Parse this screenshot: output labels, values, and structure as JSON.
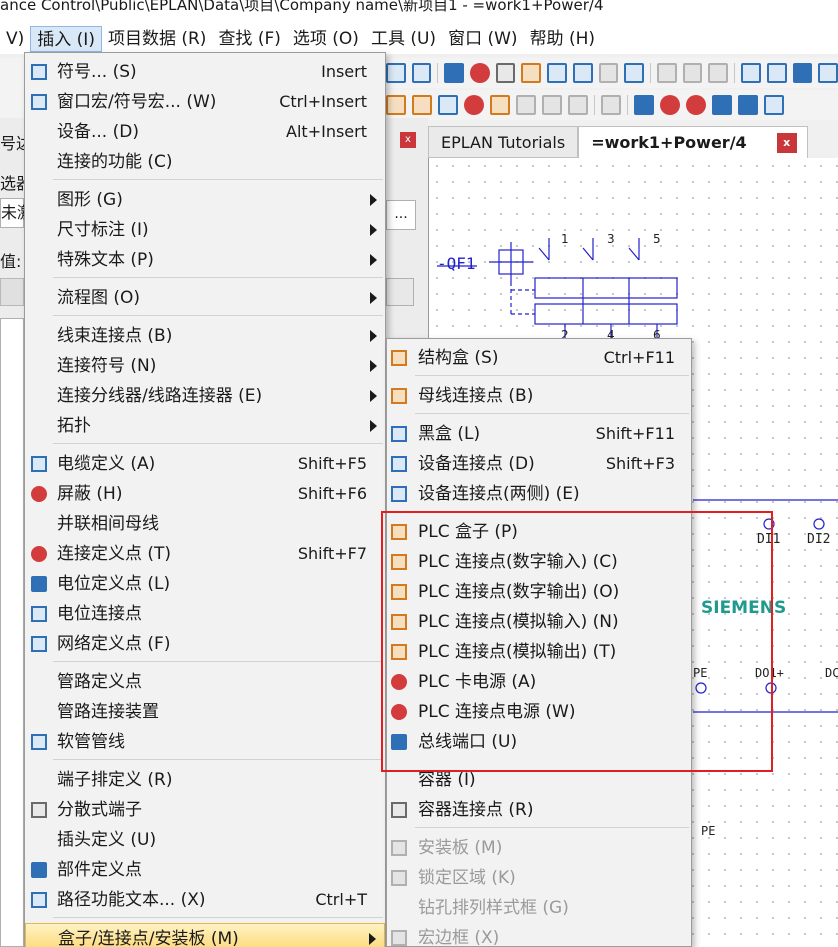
{
  "window": {
    "title": "ance Control\\Public\\EPLAN\\Data\\项目\\Company name\\新项目1 - =work1+Power/4"
  },
  "menubar": {
    "items": [
      {
        "label": "V)"
      },
      {
        "label": "插入 (I)",
        "active": true
      },
      {
        "label": "项目数据 (R)"
      },
      {
        "label": "查找 (F)"
      },
      {
        "label": "选项 (O)"
      },
      {
        "label": "工具 (U)"
      },
      {
        "label": "窗口 (W)"
      },
      {
        "label": "帮助 (H)"
      }
    ]
  },
  "left_panel": {
    "fragments": [
      "号达",
      "选器",
      "未激",
      "值:"
    ]
  },
  "tabs": [
    {
      "label": "EPLAN Tutorials"
    },
    {
      "label": "=work1+Power/4",
      "active": true,
      "close": "x"
    }
  ],
  "insert_menu": {
    "items": [
      {
        "label": "符号... (S)",
        "shortcut": "Insert",
        "icon": "symbol-icon"
      },
      {
        "label": "窗口宏/符号宏... (W)",
        "shortcut": "Ctrl+Insert",
        "icon": "macro-icon"
      },
      {
        "label": "设备... (D)",
        "shortcut": "Alt+Insert",
        "icon": ""
      },
      {
        "label": "连接的功能 (C)",
        "shortcut": "",
        "icon": ""
      },
      {
        "label": "图形 (G)",
        "submenu": true
      },
      {
        "label": "尺寸标注 (I)",
        "submenu": true
      },
      {
        "label": "特殊文本 (P)",
        "submenu": true
      },
      {
        "label": "流程图 (O)",
        "submenu": true
      },
      {
        "label": "线束连接点 (B)",
        "submenu": true
      },
      {
        "label": "连接符号 (N)",
        "submenu": true
      },
      {
        "label": "连接分线器/线路连接器 (E)",
        "submenu": true
      },
      {
        "label": "拓扑",
        "submenu": true
      },
      {
        "label": "电缆定义 (A)",
        "shortcut": "Shift+F5",
        "icon": "cable-definition-icon"
      },
      {
        "label": "屏蔽 (H)",
        "shortcut": "Shift+F6",
        "icon": "shield-icon"
      },
      {
        "label": "并联相间母线",
        "shortcut": "",
        "icon": ""
      },
      {
        "label": "连接定义点 (T)",
        "shortcut": "Shift+F7",
        "icon": "connection-definition-icon"
      },
      {
        "label": "电位定义点 (L)",
        "shortcut": "",
        "icon": "potential-definition-icon"
      },
      {
        "label": "电位连接点",
        "shortcut": "",
        "icon": "potential-connection-icon"
      },
      {
        "label": "网络定义点 (F)",
        "shortcut": "",
        "icon": "network-definition-icon"
      },
      {
        "label": "管路定义点",
        "shortcut": "",
        "icon": ""
      },
      {
        "label": "管路连接装置",
        "shortcut": "",
        "icon": ""
      },
      {
        "label": "软管管线",
        "shortcut": "",
        "icon": "hose-icon"
      },
      {
        "label": "端子排定义 (R)",
        "shortcut": "",
        "icon": ""
      },
      {
        "label": "分散式端子",
        "shortcut": "",
        "icon": "distributed-terminal-icon"
      },
      {
        "label": "插头定义 (U)",
        "shortcut": "",
        "icon": ""
      },
      {
        "label": "部件定义点",
        "shortcut": "",
        "icon": "part-definition-icon"
      },
      {
        "label": "路径功能文本... (X)",
        "shortcut": "Ctrl+T",
        "icon": "path-text-icon"
      },
      {
        "label": "盒子/连接点/安装板 (M)",
        "submenu": true,
        "highlighted": true
      }
    ]
  },
  "box_submenu": {
    "items": [
      {
        "label": "结构盒 (S)",
        "shortcut": "Ctrl+F11",
        "icon": "structure-box-icon"
      },
      {
        "label": "母线连接点 (B)",
        "shortcut": "",
        "icon": "busbar-connection-icon"
      },
      {
        "label": "黑盒 (L)",
        "shortcut": "Shift+F11",
        "icon": "black-box-icon"
      },
      {
        "label": "设备连接点 (D)",
        "shortcut": "Shift+F3",
        "icon": "device-connection-icon"
      },
      {
        "label": "设备连接点(两侧) (E)",
        "shortcut": "",
        "icon": "device-connection-both-icon"
      },
      {
        "label": "PLC 盒子 (P)",
        "shortcut": "",
        "icon": "plc-box-icon"
      },
      {
        "label": "PLC 连接点(数字输入) (C)",
        "shortcut": "",
        "icon": "plc-digital-input-icon"
      },
      {
        "label": "PLC 连接点(数字输出) (O)",
        "shortcut": "",
        "icon": "plc-digital-output-icon"
      },
      {
        "label": "PLC 连接点(模拟输入) (N)",
        "shortcut": "",
        "icon": "plc-analog-input-icon"
      },
      {
        "label": "PLC 连接点(模拟输出) (T)",
        "shortcut": "",
        "icon": "plc-analog-output-icon"
      },
      {
        "label": "PLC 卡电源 (A)",
        "shortcut": "",
        "icon": "plc-card-power-icon"
      },
      {
        "label": "PLC 连接点电源 (W)",
        "shortcut": "",
        "icon": "plc-connection-power-icon"
      },
      {
        "label": "总线端口 (U)",
        "shortcut": "",
        "icon": "bus-port-icon"
      },
      {
        "label": "容器 (I)",
        "shortcut": "",
        "icon": ""
      },
      {
        "label": "容器连接点 (R)",
        "shortcut": "",
        "icon": "container-connection-icon"
      },
      {
        "label": "安装板 (M)",
        "shortcut": "",
        "icon": "mounting-panel-icon",
        "disabled": true
      },
      {
        "label": "锁定区域 (K)",
        "shortcut": "",
        "icon": "locked-area-icon",
        "disabled": true
      },
      {
        "label": "钻孔排列样式框 (G)",
        "shortcut": "",
        "icon": "",
        "disabled": true
      },
      {
        "label": "宏边框 (X)",
        "shortcut": "",
        "icon": "macro-frame-icon",
        "disabled": true
      }
    ]
  },
  "schematic": {
    "breaker_label": "-QF1",
    "pins_top": [
      "1",
      "3",
      "5"
    ],
    "pins_bottom": [
      "2",
      "4",
      "6"
    ],
    "plc_labels": [
      "DI1",
      "DI2"
    ],
    "brand": "SIEMENS",
    "lower_labels": [
      "PE",
      "DO1+",
      "DC"
    ],
    "pe_label": "PE",
    "brand_color": "#1f9a8e"
  }
}
